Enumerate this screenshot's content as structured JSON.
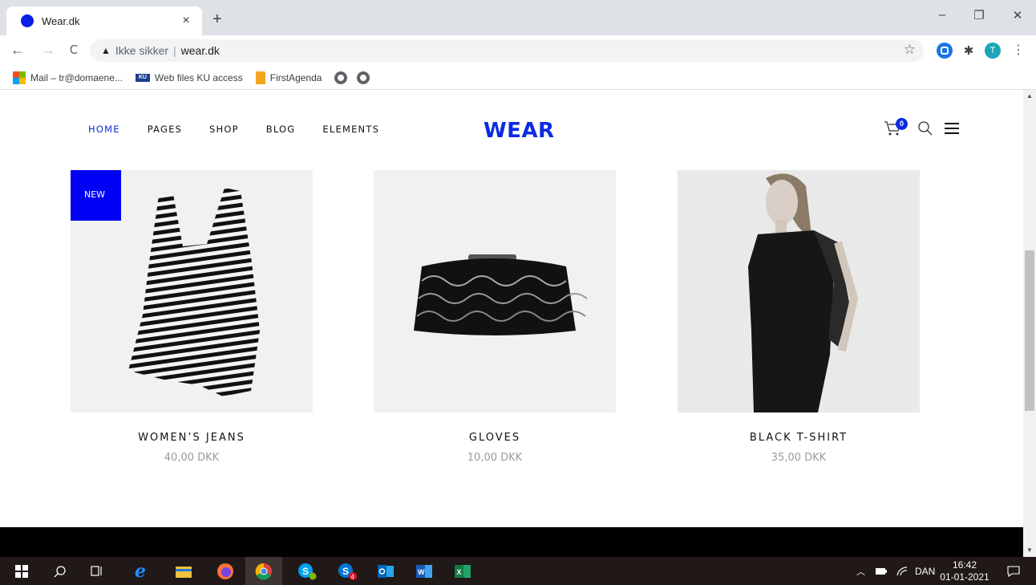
{
  "browser": {
    "tab_title": "Wear.dk",
    "tab_close": "×",
    "new_tab": "+",
    "minimize": "–",
    "restore": "❐",
    "close": "✕",
    "back": "←",
    "forward": "→",
    "reload": "C",
    "security_warning": "Ikke sikker",
    "separator": "|",
    "url": "wear.dk",
    "star": "☆",
    "avatar_initial": "T",
    "menu": "⋮",
    "extension_puzzle": "✱"
  },
  "bookmarks": [
    {
      "label": "Mail – tr@domaene...",
      "icon": "microsoft-icon"
    },
    {
      "label": "Web files KU access",
      "icon": "ku-icon"
    },
    {
      "label": "FirstAgenda",
      "icon": "firstagenda-icon"
    }
  ],
  "site": {
    "nav": [
      "HOME",
      "PAGES",
      "SHOP",
      "BLOG",
      "ELEMENTS"
    ],
    "active_nav": "HOME",
    "logo": "WEAR",
    "cart_count": "0",
    "accent_color": "#0b2be0"
  },
  "products": [
    {
      "name": "WOMEN’S JEANS",
      "price": "40,00 DKK",
      "badge": "NEW",
      "image": "striped-romper"
    },
    {
      "name": "GLOVES",
      "price": "10,00 DKK",
      "image": "black-ruffled-clutch"
    },
    {
      "name": "BLACK T-SHIRT",
      "price": "35,00 DKK",
      "image": "model-in-black"
    }
  ],
  "taskbar": {
    "language": "DAN",
    "time": "16:42",
    "date": "01-01-2021",
    "skype_badge": "4"
  }
}
